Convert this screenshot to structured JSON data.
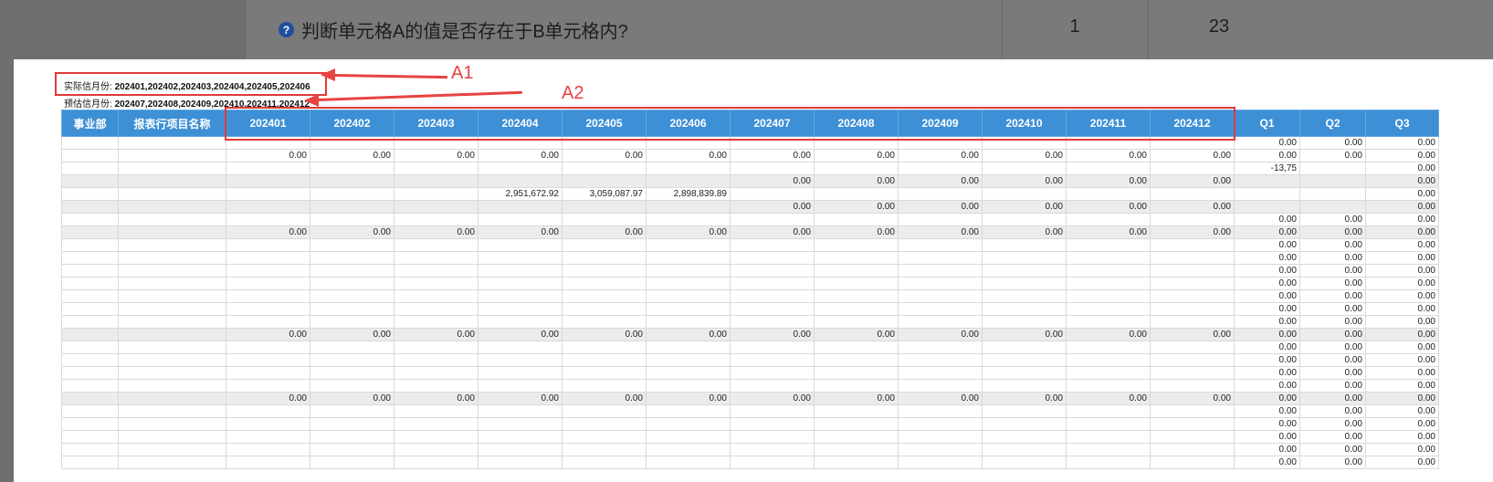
{
  "background": {
    "question_title": "判断单元格A的值是否存在于B单元格内?",
    "stat1": "1",
    "stat2": "23"
  },
  "info": {
    "actual_label": "实际信月份:",
    "actual_value": "202401,202402,202403,202404,202405,202406",
    "forecast_label": "预估信月份:",
    "forecast_value": "202407,202408,202409,202410,202411,202412"
  },
  "annotations": {
    "a1": "A1",
    "a2": "A2"
  },
  "table": {
    "headers": [
      "事业部",
      "报表行项目名称",
      "202401",
      "202402",
      "202403",
      "202404",
      "202405",
      "202406",
      "202407",
      "202408",
      "202409",
      "202410",
      "202411",
      "202412",
      "Q1",
      "Q2",
      "Q3"
    ],
    "rows": [
      {
        "sum": false,
        "dept": "",
        "item": "",
        "m": [
          "",
          "",
          "",
          "",
          "",
          "",
          "",
          "",
          "",
          "",
          "",
          ""
        ],
        "q": [
          "0.00",
          "0.00",
          "0.00"
        ]
      },
      {
        "sum": false,
        "dept": "",
        "item": "",
        "m": [
          "0.00",
          "0.00",
          "0.00",
          "0.00",
          "0.00",
          "0.00",
          "0.00",
          "0.00",
          "0.00",
          "0.00",
          "0.00",
          "0.00"
        ],
        "q": [
          "0.00",
          "0.00",
          "0.00"
        ]
      },
      {
        "sum": false,
        "dept": "",
        "item": "",
        "m": [
          "",
          "",
          "",
          "",
          "",
          "",
          "",
          "",
          "",
          "",
          "",
          ""
        ],
        "q": [
          "-13,75",
          "",
          "0.00"
        ]
      },
      {
        "sum": true,
        "dept": "",
        "item": "",
        "m": [
          "",
          "",
          "",
          "",
          "",
          "",
          "0.00",
          "0.00",
          "0.00",
          "0.00",
          "0.00",
          "0.00"
        ],
        "q": [
          "",
          "",
          "0.00"
        ]
      },
      {
        "sum": false,
        "dept": "",
        "item": "",
        "m": [
          "",
          "",
          "",
          "2,951,672.92",
          "3,059,087.97",
          "2,898,839.89",
          "",
          "",
          "",
          "",
          "",
          ""
        ],
        "q": [
          "",
          "",
          "0.00"
        ]
      },
      {
        "sum": true,
        "dept": "",
        "item": "",
        "m": [
          "",
          "",
          "",
          "",
          "",
          "",
          "0.00",
          "0.00",
          "0.00",
          "0.00",
          "0.00",
          "0.00"
        ],
        "q": [
          "",
          "",
          "0.00"
        ]
      },
      {
        "sum": false,
        "dept": "",
        "item": "",
        "m": [
          "",
          "",
          "",
          "",
          "",
          "",
          "",
          "",
          "",
          "",
          "",
          ""
        ],
        "q": [
          "0.00",
          "0.00",
          "0.00"
        ]
      },
      {
        "sum": true,
        "dept": "",
        "item": "",
        "m": [
          "0.00",
          "0.00",
          "0.00",
          "0.00",
          "0.00",
          "0.00",
          "0.00",
          "0.00",
          "0.00",
          "0.00",
          "0.00",
          "0.00"
        ],
        "q": [
          "0.00",
          "0.00",
          "0.00"
        ]
      },
      {
        "sum": false,
        "dept": "",
        "item": "",
        "m": [
          "",
          "",
          "",
          "",
          "",
          "",
          "",
          "",
          "",
          "",
          "",
          ""
        ],
        "q": [
          "0.00",
          "0.00",
          "0.00"
        ]
      },
      {
        "sum": false,
        "dept": "",
        "item": "",
        "m": [
          "",
          "",
          "",
          "",
          "",
          "",
          "",
          "",
          "",
          "",
          "",
          ""
        ],
        "q": [
          "0.00",
          "0.00",
          "0.00"
        ]
      },
      {
        "sum": false,
        "dept": "",
        "item": "",
        "m": [
          "",
          "",
          "",
          "",
          "",
          "",
          "",
          "",
          "",
          "",
          "",
          ""
        ],
        "q": [
          "0.00",
          "0.00",
          "0.00"
        ]
      },
      {
        "sum": false,
        "dept": "",
        "item": "",
        "m": [
          "",
          "",
          "",
          "",
          "",
          "",
          "",
          "",
          "",
          "",
          "",
          ""
        ],
        "q": [
          "0.00",
          "0.00",
          "0.00"
        ]
      },
      {
        "sum": false,
        "dept": "",
        "item": "",
        "m": [
          "",
          "",
          "",
          "",
          "",
          "",
          "",
          "",
          "",
          "",
          "",
          ""
        ],
        "q": [
          "0.00",
          "0.00",
          "0.00"
        ]
      },
      {
        "sum": false,
        "dept": "",
        "item": "",
        "m": [
          "",
          "",
          "",
          "",
          "",
          "",
          "",
          "",
          "",
          "",
          "",
          ""
        ],
        "q": [
          "0.00",
          "0.00",
          "0.00"
        ]
      },
      {
        "sum": false,
        "dept": "",
        "item": "",
        "m": [
          "",
          "",
          "",
          "",
          "",
          "",
          "",
          "",
          "",
          "",
          "",
          ""
        ],
        "q": [
          "0.00",
          "0.00",
          "0.00"
        ]
      },
      {
        "sum": true,
        "dept": "",
        "item": "",
        "m": [
          "0.00",
          "0.00",
          "0.00",
          "0.00",
          "0.00",
          "0.00",
          "0.00",
          "0.00",
          "0.00",
          "0.00",
          "0.00",
          "0.00"
        ],
        "q": [
          "0.00",
          "0.00",
          "0.00"
        ]
      },
      {
        "sum": false,
        "dept": "",
        "item": "",
        "m": [
          "",
          "",
          "",
          "",
          "",
          "",
          "",
          "",
          "",
          "",
          "",
          ""
        ],
        "q": [
          "0.00",
          "0.00",
          "0.00"
        ]
      },
      {
        "sum": false,
        "dept": "",
        "item": "",
        "m": [
          "",
          "",
          "",
          "",
          "",
          "",
          "",
          "",
          "",
          "",
          "",
          ""
        ],
        "q": [
          "0.00",
          "0.00",
          "0.00"
        ]
      },
      {
        "sum": false,
        "dept": "",
        "item": "",
        "m": [
          "",
          "",
          "",
          "",
          "",
          "",
          "",
          "",
          "",
          "",
          "",
          ""
        ],
        "q": [
          "0.00",
          "0.00",
          "0.00"
        ]
      },
      {
        "sum": false,
        "dept": "",
        "item": "",
        "m": [
          "",
          "",
          "",
          "",
          "",
          "",
          "",
          "",
          "",
          "",
          "",
          ""
        ],
        "q": [
          "0.00",
          "0.00",
          "0.00"
        ]
      },
      {
        "sum": true,
        "dept": "",
        "item": "",
        "m": [
          "0.00",
          "0.00",
          "0.00",
          "0.00",
          "0.00",
          "0.00",
          "0.00",
          "0.00",
          "0.00",
          "0.00",
          "0.00",
          "0.00"
        ],
        "q": [
          "0.00",
          "0.00",
          "0.00"
        ]
      },
      {
        "sum": false,
        "dept": "",
        "item": "",
        "m": [
          "",
          "",
          "",
          "",
          "",
          "",
          "",
          "",
          "",
          "",
          "",
          ""
        ],
        "q": [
          "0.00",
          "0.00",
          "0.00"
        ]
      },
      {
        "sum": false,
        "dept": "",
        "item": "",
        "m": [
          "",
          "",
          "",
          "",
          "",
          "",
          "",
          "",
          "",
          "",
          "",
          ""
        ],
        "q": [
          "0.00",
          "0.00",
          "0.00"
        ]
      },
      {
        "sum": false,
        "dept": "",
        "item": "",
        "m": [
          "",
          "",
          "",
          "",
          "",
          "",
          "",
          "",
          "",
          "",
          "",
          ""
        ],
        "q": [
          "0.00",
          "0.00",
          "0.00"
        ]
      },
      {
        "sum": false,
        "dept": "",
        "item": "",
        "m": [
          "",
          "",
          "",
          "",
          "",
          "",
          "",
          "",
          "",
          "",
          "",
          ""
        ],
        "q": [
          "0.00",
          "0.00",
          "0.00"
        ]
      },
      {
        "sum": false,
        "dept": "",
        "item": "",
        "m": [
          "",
          "",
          "",
          "",
          "",
          "",
          "",
          "",
          "",
          "",
          "",
          ""
        ],
        "q": [
          "0.00",
          "0.00",
          "0.00"
        ]
      }
    ]
  }
}
